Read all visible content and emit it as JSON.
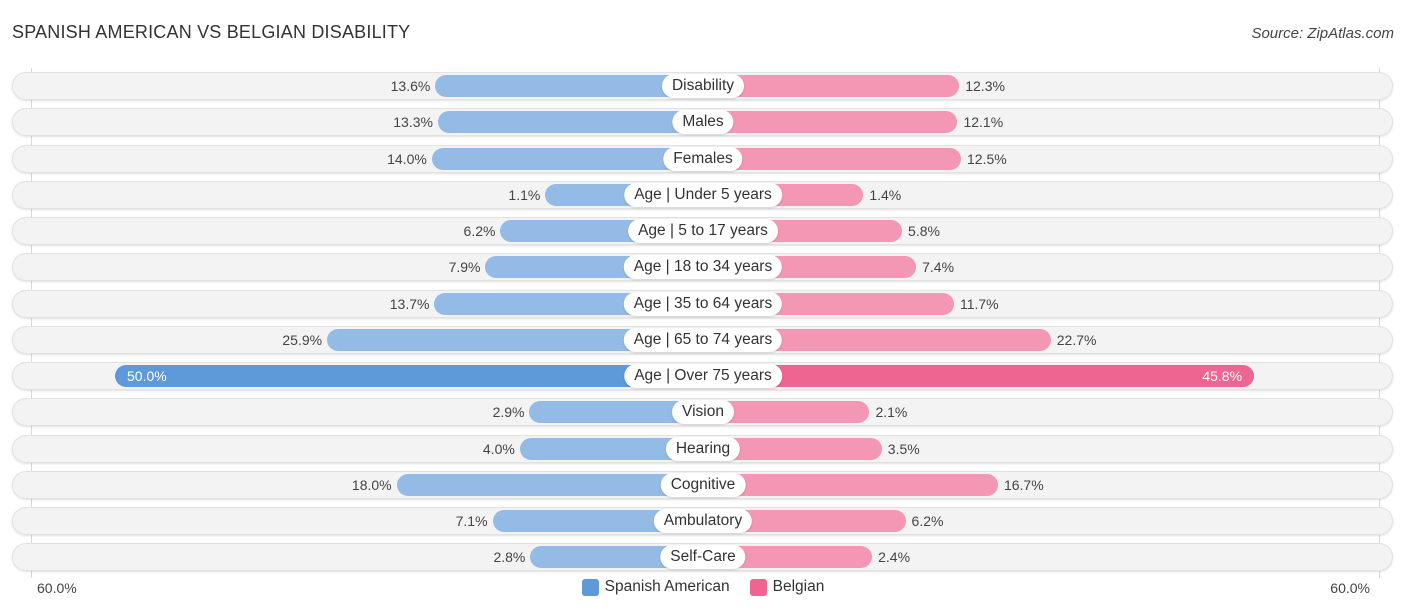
{
  "header": {
    "title": "SPANISH AMERICAN VS BELGIAN DISABILITY",
    "source": "Source: ZipAtlas.com"
  },
  "colors": {
    "spanish_american": "#94bae6",
    "spanish_american_highlight": "#5e9ad9",
    "belgian": "#f497b4",
    "belgian_highlight": "#ef6591"
  },
  "axis": {
    "left_label": "60.0%",
    "right_label": "60.0%"
  },
  "legend": {
    "items": [
      {
        "label": "Spanish American",
        "color": "#5e9ad9"
      },
      {
        "label": "Belgian",
        "color": "#ef6591"
      }
    ]
  },
  "chart_data": {
    "type": "bar",
    "orientation": "horizontal-diverging",
    "title": "SPANISH AMERICAN VS BELGIAN DISABILITY",
    "xlabel": "",
    "ylabel": "",
    "xlim": [
      -60,
      60
    ],
    "unit": "%",
    "legend_position": "bottom-center",
    "categories": [
      "Disability",
      "Males",
      "Females",
      "Age | Under 5 years",
      "Age | 5 to 17 years",
      "Age | 18 to 34 years",
      "Age | 35 to 64 years",
      "Age | 65 to 74 years",
      "Age | Over 75 years",
      "Vision",
      "Hearing",
      "Cognitive",
      "Ambulatory",
      "Self-Care"
    ],
    "series": [
      {
        "name": "Spanish American",
        "side": "left",
        "values": [
          13.6,
          13.3,
          14.0,
          1.1,
          6.2,
          7.9,
          13.7,
          25.9,
          50.0,
          2.9,
          4.0,
          18.0,
          7.1,
          2.8
        ],
        "labels": [
          "13.6%",
          "13.3%",
          "14.0%",
          "1.1%",
          "6.2%",
          "7.9%",
          "13.7%",
          "25.9%",
          "50.0%",
          "2.9%",
          "4.0%",
          "18.0%",
          "7.1%",
          "2.8%"
        ]
      },
      {
        "name": "Belgian",
        "side": "right",
        "values": [
          12.3,
          12.1,
          12.5,
          1.4,
          5.8,
          7.4,
          11.7,
          22.7,
          45.8,
          2.1,
          3.5,
          16.7,
          6.2,
          2.4
        ],
        "labels": [
          "12.3%",
          "12.1%",
          "12.5%",
          "1.4%",
          "5.8%",
          "7.4%",
          "11.7%",
          "22.7%",
          "45.8%",
          "2.1%",
          "3.5%",
          "16.7%",
          "6.2%",
          "2.4%"
        ]
      }
    ],
    "highlighted_category_index": 8
  }
}
